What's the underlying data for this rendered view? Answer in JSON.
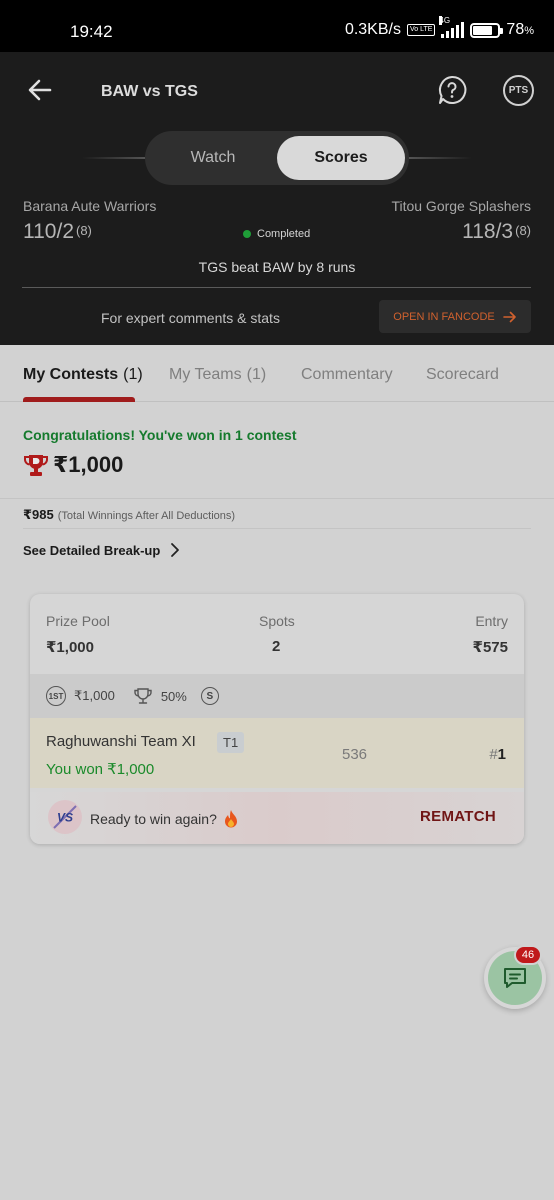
{
  "status_bar": {
    "time": "19:42",
    "network_speed": "0.3KB/s",
    "volte": "Vo LTE",
    "network_type": "4G",
    "battery_percent": "78",
    "battery_symbol": "%"
  },
  "header": {
    "title": "BAW vs TGS",
    "toggle": {
      "watch": "Watch",
      "scores": "Scores",
      "selected": "Scores"
    },
    "team_left": {
      "name": "Barana Aute Warriors",
      "score": "110/2",
      "overs": "(8)"
    },
    "team_right": {
      "name": "Titou Gorge Splashers",
      "score": "118/3",
      "overs": "(8)"
    },
    "status": "Completed",
    "result": "TGS beat BAW by 8 runs",
    "expert_text": "For expert comments & stats",
    "fancode_button": "OPEN IN FANCODE"
  },
  "tabs": [
    {
      "label": "My Contests",
      "count": "(1)"
    },
    {
      "label": "My Teams",
      "count": "(1)"
    },
    {
      "label": "Commentary"
    },
    {
      "label": "Scorecard"
    }
  ],
  "winnings": {
    "congrats": "Congratulations! You've won in 1 contest",
    "amount": "₹1,000",
    "net_amount": "₹985",
    "net_note": "(Total Winnings After All Deductions)",
    "breakup_link": "See Detailed Break-up"
  },
  "contest_card": {
    "prize_pool_label": "Prize Pool",
    "prize_pool": "₹1,000",
    "spots_label": "Spots",
    "spots": "2",
    "entry_label": "Entry",
    "entry": "₹575",
    "first_badge": "1ST",
    "first_prize": "₹1,000",
    "winners_pct": "50%",
    "single_badge": "S",
    "team_name": "Raghuwanshi Team XI",
    "team_tag": "T1",
    "won_text": "You won ₹1,000",
    "points": "536",
    "rank_hash": "#",
    "rank": "1",
    "vs_badge": "VS",
    "ready_text": "Ready to win again?",
    "rematch": "REMATCH"
  },
  "chat_fab": {
    "badge": "46"
  },
  "colors": {
    "accent_red": "#a01c1c",
    "win_green": "#157a2d",
    "fancode_orange": "#d0612e",
    "header_bg": "#1c1c1c"
  }
}
